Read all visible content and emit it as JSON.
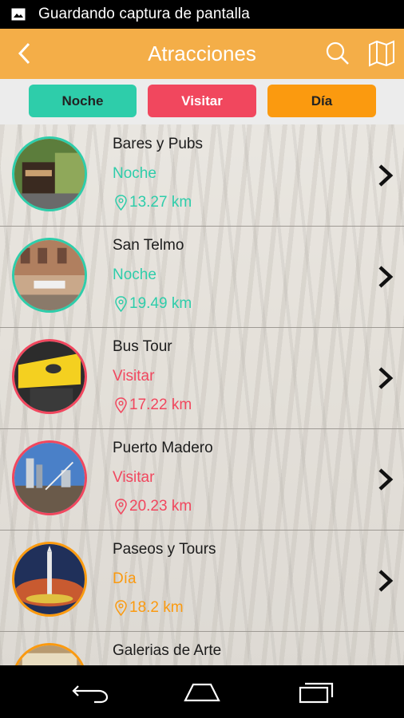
{
  "status_bar": {
    "icon": "image-icon",
    "text": "Guardando captura de pantalla"
  },
  "app_bar": {
    "title": "Atracciones",
    "back_icon": "chevron-left-icon",
    "search_icon": "search-icon",
    "map_icon": "map-icon",
    "color": "#f4ae48"
  },
  "filters": [
    {
      "label": "Noche",
      "color": "#2ecdaa"
    },
    {
      "label": "Visitar",
      "color": "#f1475e"
    },
    {
      "label": "Día",
      "color": "#fb9a0f"
    }
  ],
  "items": [
    {
      "name": "Bares y Pubs",
      "category": "Noche",
      "distance": "13.27 km",
      "color": "#2ecdaa"
    },
    {
      "name": "San Telmo",
      "category": "Noche",
      "distance": "19.49 km",
      "color": "#2ecdaa"
    },
    {
      "name": "Bus Tour",
      "category": "Visitar",
      "distance": "17.22 km",
      "color": "#f1475e"
    },
    {
      "name": "Puerto Madero",
      "category": "Visitar",
      "distance": "20.23 km",
      "color": "#f1475e"
    },
    {
      "name": "Paseos y Tours",
      "category": "Día",
      "distance": "18.2 km",
      "color": "#fb9a0f"
    },
    {
      "name": "Galerias de Arte",
      "category": "",
      "distance": "",
      "color": "#fb9a0f"
    }
  ],
  "nav_bar": {
    "back": "back-icon",
    "home": "home-icon",
    "recents": "recents-icon"
  }
}
